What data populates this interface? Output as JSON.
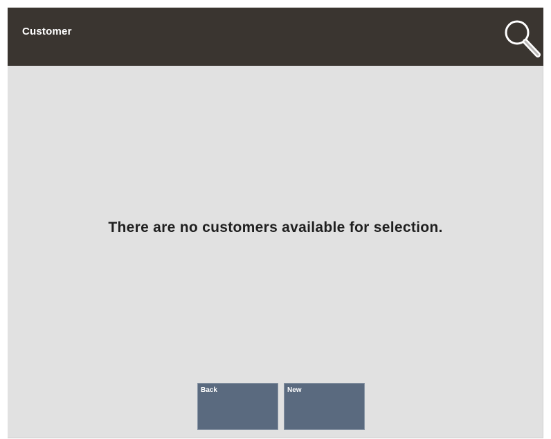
{
  "header": {
    "title": "Customer",
    "search_icon": "search-icon",
    "background_color": "#3a3530"
  },
  "main": {
    "message": "There are no customers available for selection."
  },
  "buttons": {
    "back_label": "Back",
    "new_label": "New",
    "color": "#5a6a7f"
  }
}
